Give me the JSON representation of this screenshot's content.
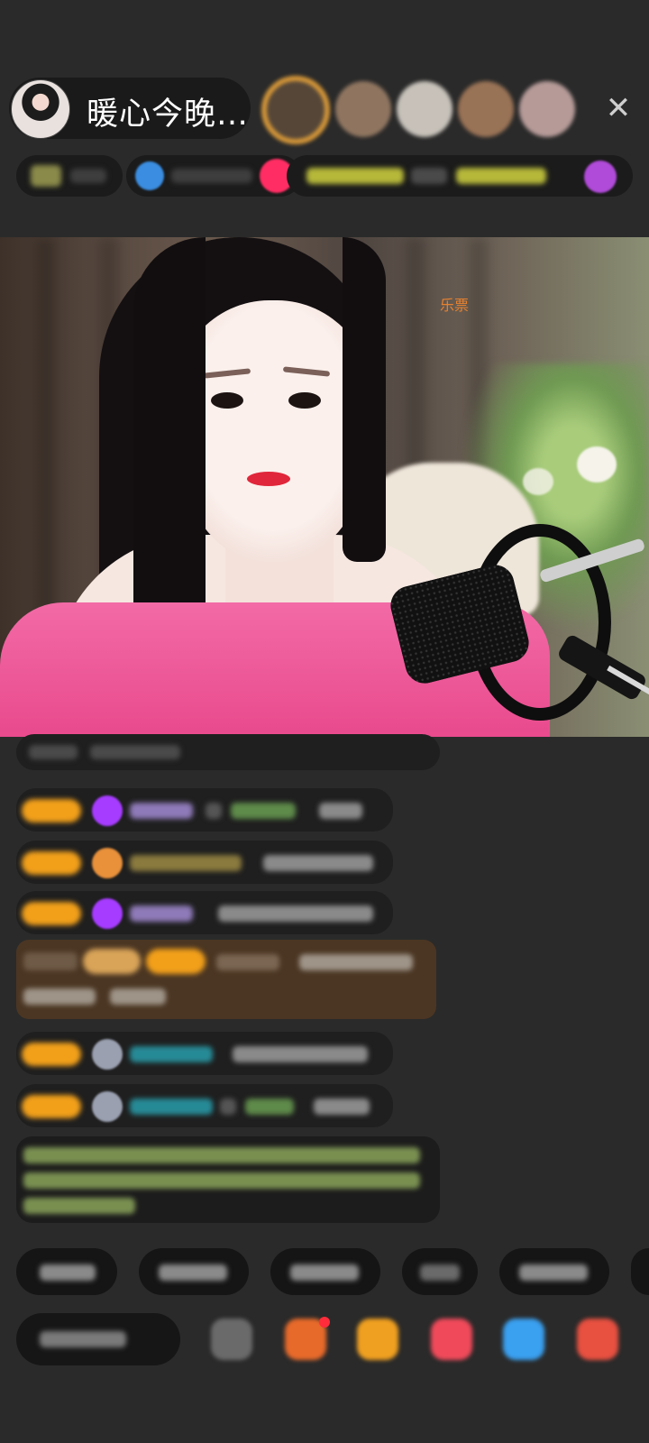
{
  "header": {
    "host_name": "暖心今晚…",
    "close_icon": "close-icon",
    "viewer_avatar_colors": [
      "#d98f45",
      "#b88a6a",
      "#d6c7b4",
      "#b8805e",
      "#c7a9a5"
    ]
  },
  "video": {
    "watermark": "乐票"
  },
  "chat": {
    "message_count": 9
  },
  "colors": {
    "badge": "#f2a01a",
    "gem_purple": "#a63cff",
    "cyan_name": "#2ab8c9",
    "green_notice": "#b3d46e",
    "highlight_bg": "#4b3623"
  }
}
